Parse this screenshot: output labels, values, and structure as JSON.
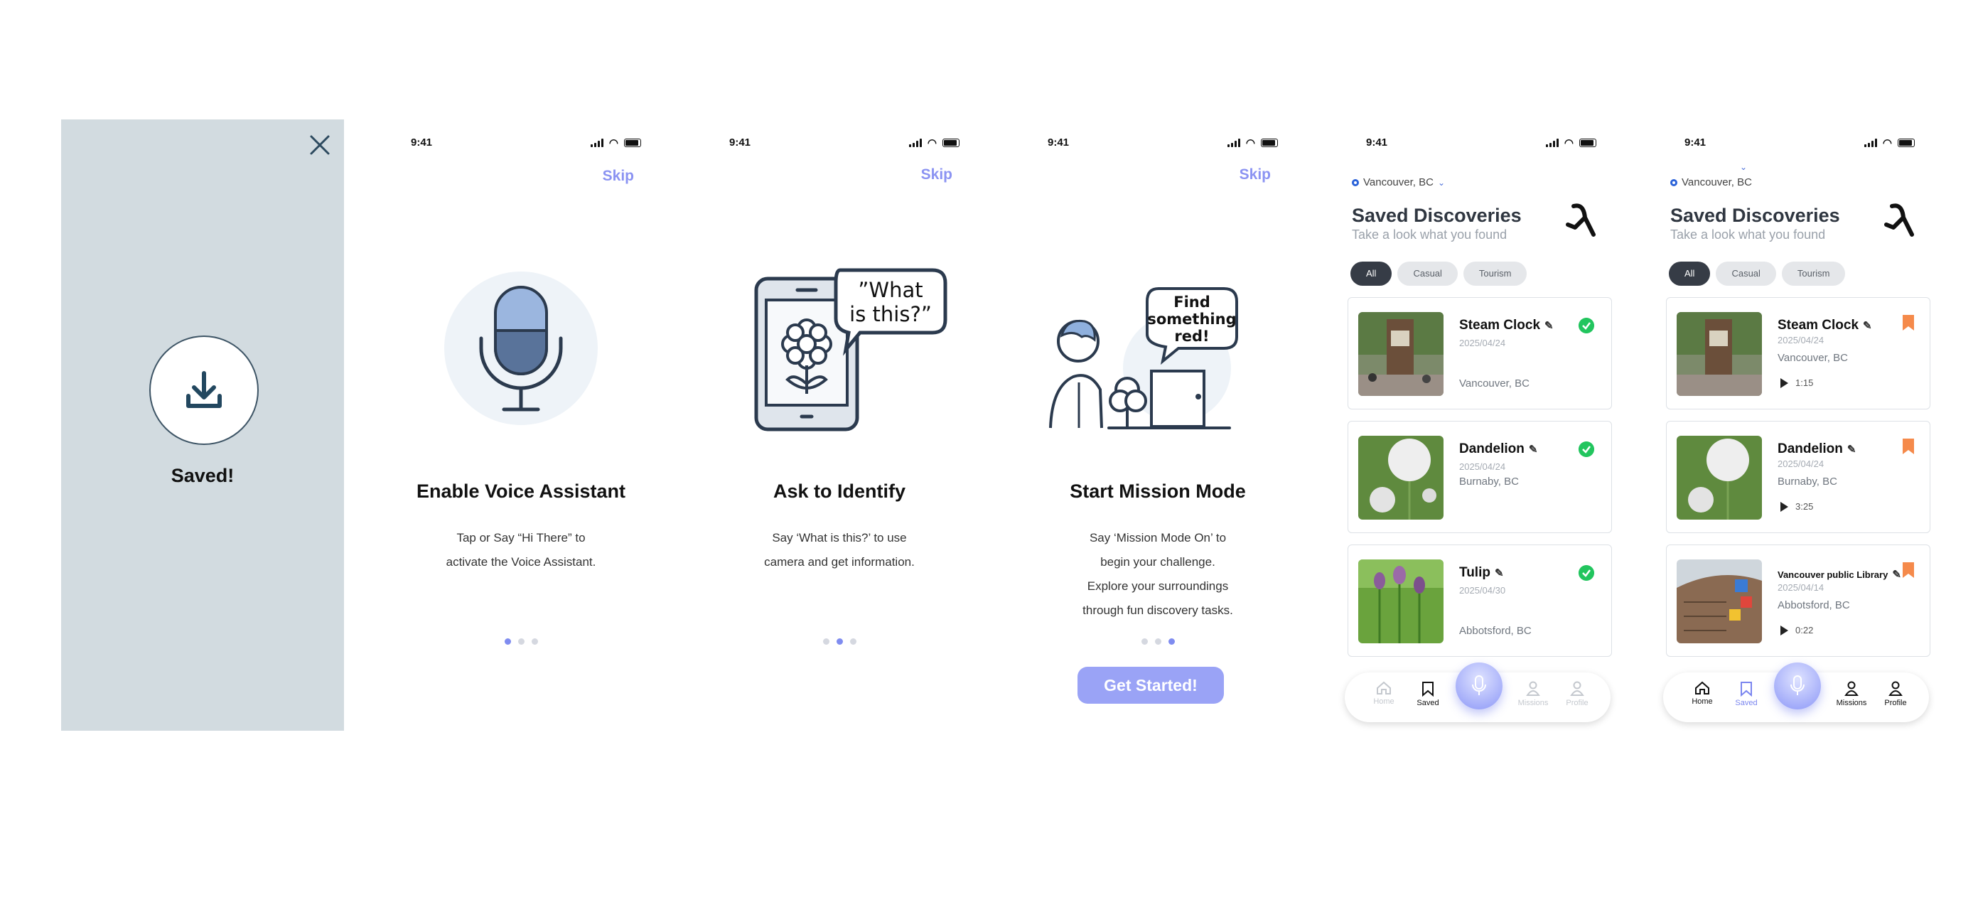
{
  "status": {
    "time": "9:41"
  },
  "saved_modal": {
    "label": "Saved!"
  },
  "onboarding": [
    {
      "skip": "Skip",
      "title": "Enable Voice Assistant",
      "body": [
        "Tap or Say “Hi There” to",
        "activate the Voice Assistant."
      ],
      "active_dot": 0
    },
    {
      "skip": "Skip",
      "title": "Ask to Identify",
      "bubble": [
        "”What",
        "is this?”"
      ],
      "body": [
        "Say ‘What is this?’ to use",
        "camera and get information."
      ],
      "active_dot": 1
    },
    {
      "skip": "Skip",
      "title": "Start Mission Mode",
      "bubble": [
        "Find",
        "something",
        "red!"
      ],
      "body": [
        "Say ‘Mission Mode On’ to",
        "begin your challenge.",
        "Explore your surroundings",
        "through fun discovery tasks."
      ],
      "active_dot": 2,
      "cta": "Get Started!"
    }
  ],
  "saved_a": {
    "location": "Vancouver, BC",
    "title": "Saved Discoveries",
    "subtitle": "Take a look what you found",
    "chips": [
      "All",
      "Casual",
      "Tourism"
    ],
    "items": [
      {
        "name": "Steam Clock",
        "date": "2025/04/24",
        "place": "Vancouver, BC"
      },
      {
        "name": "Dandelion",
        "date": "2025/04/24",
        "place": "Burnaby, BC"
      },
      {
        "name": "Tulip",
        "date": "2025/04/30",
        "place": "Abbotsford, BC"
      }
    ],
    "tabs": [
      "Home",
      "Saved",
      "Missions",
      "Profile"
    ]
  },
  "saved_b": {
    "location": "Vancouver, BC",
    "title": "Saved Discoveries",
    "subtitle": "Take a look what you found",
    "chips": [
      "All",
      "Casual",
      "Tourism"
    ],
    "items": [
      {
        "name": "Steam Clock",
        "date": "2025/04/24",
        "place": "Vancouver, BC",
        "duration": "1:15"
      },
      {
        "name": "Dandelion",
        "date": "2025/04/24",
        "place": "Burnaby, BC",
        "duration": "3:25"
      },
      {
        "name": "Vancouver public Library",
        "date": "2025/04/14",
        "place": "Abbotsford, BC",
        "duration": "0:22"
      }
    ],
    "tabs": [
      "Home",
      "Saved",
      "Missions",
      "Profile"
    ]
  },
  "colors": {
    "accent": "#8b93f2",
    "check": "#22c55e",
    "bookmark": "#f58a4b",
    "panel": "#d2dbe0"
  }
}
